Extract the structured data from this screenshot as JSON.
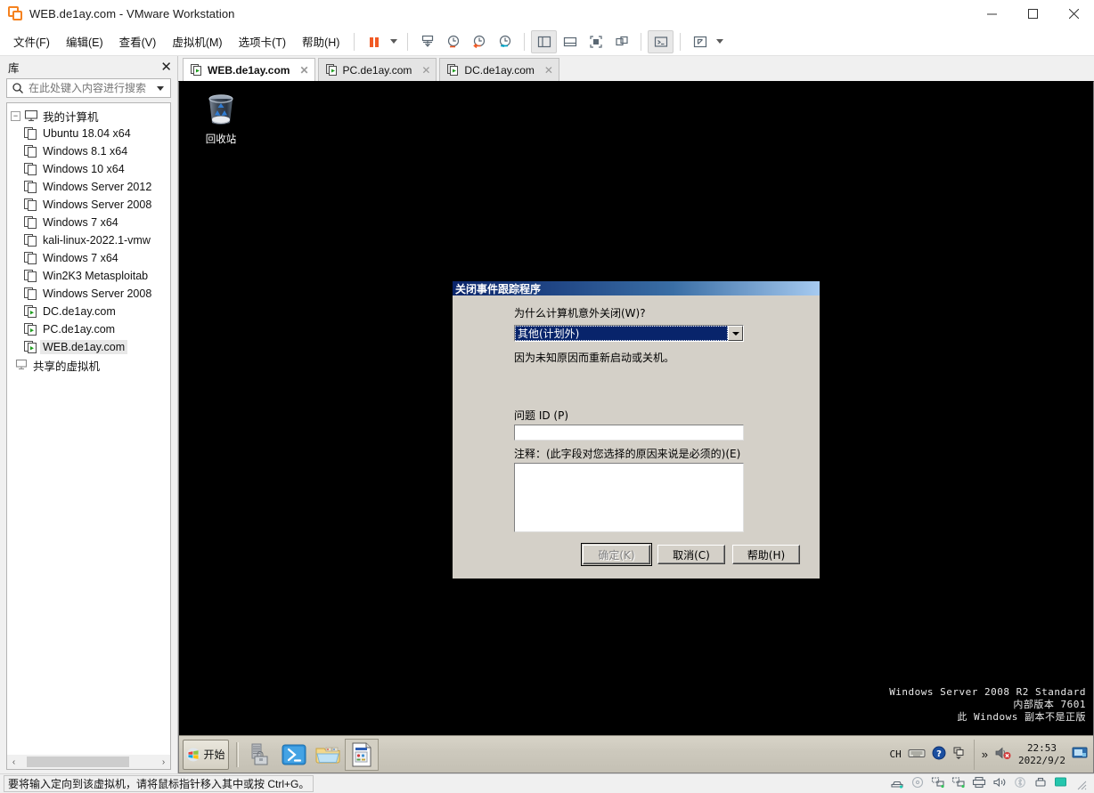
{
  "window": {
    "title": "WEB.de1ay.com - VMware Workstation",
    "app_icon": "vmware-logo-icon",
    "minimize_label": "─",
    "maximize_label": "□",
    "close_label": "✕"
  },
  "menubar": {
    "items": [
      {
        "label": "文件(F)",
        "name": "menu-file"
      },
      {
        "label": "编辑(E)",
        "name": "menu-edit"
      },
      {
        "label": "查看(V)",
        "name": "menu-view"
      },
      {
        "label": "虚拟机(M)",
        "name": "menu-vm"
      },
      {
        "label": "选项卡(T)",
        "name": "menu-tabs"
      },
      {
        "label": "帮助(H)",
        "name": "menu-help"
      }
    ],
    "toolbar_icons": [
      "pause-icon",
      "power-dropdown-caret-icon",
      "snapshot-take-icon",
      "snapshot-manage-icon",
      "snapshot-revert-icon",
      "snapshot-manager-icon",
      "show-library-icon",
      "show-thumbnail-bar-icon",
      "fullscreen-icon",
      "unity-icon",
      "console-icon",
      "stretch-icon",
      "stretch-caret-icon"
    ]
  },
  "sidebar": {
    "title": "库",
    "close_label": "✕",
    "search": {
      "placeholder": "在此处键入内容进行搜索",
      "value": "",
      "icon": "search-icon"
    },
    "tree": {
      "root": {
        "label": "我的计算机",
        "icon": "monitor-icon",
        "expander": "−"
      },
      "items": [
        {
          "label": "Ubuntu 18.04 x64",
          "icon": "vm-icon",
          "running": false,
          "selected": false
        },
        {
          "label": "Windows 8.1 x64",
          "icon": "vm-icon",
          "running": false,
          "selected": false
        },
        {
          "label": "Windows 10 x64",
          "icon": "vm-icon",
          "running": false,
          "selected": false
        },
        {
          "label": "Windows Server 2012",
          "icon": "vm-icon",
          "running": false,
          "selected": false
        },
        {
          "label": "Windows Server 2008",
          "icon": "vm-icon",
          "running": false,
          "selected": false
        },
        {
          "label": "Windows 7 x64",
          "icon": "vm-icon",
          "running": false,
          "selected": false
        },
        {
          "label": "kali-linux-2022.1-vmw",
          "icon": "vm-icon",
          "running": false,
          "selected": false
        },
        {
          "label": "Windows 7 x64",
          "icon": "vm-icon",
          "running": false,
          "selected": false
        },
        {
          "label": "Win2K3 Metasploitab",
          "icon": "vm-icon",
          "running": false,
          "selected": false
        },
        {
          "label": "Windows Server 2008",
          "icon": "vm-icon",
          "running": false,
          "selected": false
        },
        {
          "label": "DC.de1ay.com",
          "icon": "vm-running-icon",
          "running": true,
          "selected": false
        },
        {
          "label": "PC.de1ay.com",
          "icon": "vm-running-icon",
          "running": true,
          "selected": false
        },
        {
          "label": "WEB.de1ay.com",
          "icon": "vm-running-icon",
          "running": true,
          "selected": true
        }
      ],
      "shared": {
        "label": "共享的虚拟机",
        "icon": "shared-vm-icon"
      }
    },
    "scroll_left": "‹",
    "scroll_right": "›"
  },
  "tabs": [
    {
      "label": "WEB.de1ay.com",
      "active": true,
      "close": "✕",
      "icon": "vm-running-icon"
    },
    {
      "label": "PC.de1ay.com",
      "active": false,
      "close": "✕",
      "icon": "vm-running-icon"
    },
    {
      "label": "DC.de1ay.com",
      "active": false,
      "close": "✕",
      "icon": "vm-running-icon"
    }
  ],
  "guest": {
    "desktop_icons": [
      {
        "label": "回收站",
        "icon": "recycle-bin-icon"
      }
    ],
    "watermark": {
      "line1": "Windows Server 2008 R2 Standard",
      "line2": "内部版本 7601",
      "line3": "此 Windows 副本不是正版"
    },
    "taskbar": {
      "start_label": "开始",
      "quick_launch": [
        {
          "name": "server-manager-icon"
        },
        {
          "name": "powershell-icon"
        },
        {
          "name": "windows-explorer-icon"
        }
      ],
      "open_windows": [
        {
          "name": "shutdown-event-tracker-task",
          "icon": "dialog-window-icon"
        }
      ],
      "tray": {
        "input_language": "CH",
        "items": [
          "keyboard-icon",
          "help-icon",
          "show-hidden-icons-icon"
        ],
        "notify_expander": "»",
        "volume_icon": "volume-muted-icon",
        "time": "22:53",
        "date": "2022/9/2",
        "show_desktop": "show-desktop-icon"
      }
    },
    "dialog": {
      "title": "关闭事件跟踪程序",
      "question": "为什么计算机意外关闭(W)?",
      "reason_selected": "其他(计划外)",
      "reason_description": "因为未知原因而重新启动或关机。",
      "problem_id_label": "问题 ID (P)",
      "problem_id_value": "",
      "comment_label": "注释：(此字段对您选择的原因来说是必须的)(E)",
      "comment_value": "",
      "buttons": [
        {
          "label": "确定(K)",
          "name": "ok-button",
          "disabled": true
        },
        {
          "label": "取消(C)",
          "name": "cancel-button",
          "disabled": false
        },
        {
          "label": "帮助(H)",
          "name": "help-button",
          "disabled": false
        }
      ]
    }
  },
  "statusbar": {
    "message": "要将输入定向到该虚拟机，请将鼠标指针移入其中或按 Ctrl+G。",
    "device_icons": [
      "hard-disk-icon",
      "cd-dvd-icon",
      "network-adapter-icon",
      "network-adapter-2-icon",
      "printer-icon",
      "sound-card-icon",
      "bluetooth-icon",
      "usb-icon",
      "display-icon"
    ]
  },
  "colors": {
    "accent": "#f58220",
    "dialog_face": "#d4d0c8",
    "dialog_title_start": "#0a246a",
    "dialog_title_end": "#a6caf0",
    "combo_highlight": "#08246b",
    "taskbar": "#cdc9bd",
    "running_green": "#2aa02a"
  }
}
